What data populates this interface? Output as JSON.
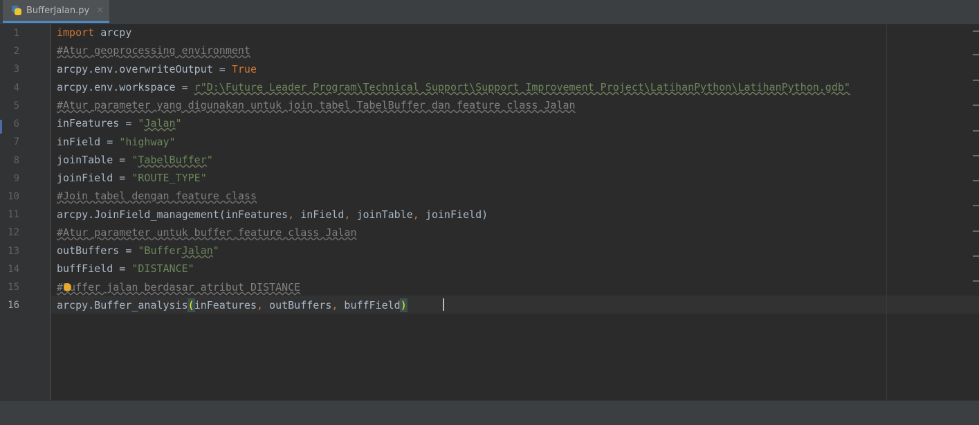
{
  "tab": {
    "filename": "BufferJalan.py",
    "close_glyph": "✕",
    "icon": "python-file-icon"
  },
  "gutter": {
    "line_numbers": [
      "1",
      "2",
      "3",
      "4",
      "5",
      "6",
      "7",
      "8",
      "9",
      "10",
      "11",
      "12",
      "13",
      "14",
      "15",
      "16"
    ],
    "current_line": "16"
  },
  "code": {
    "l1": {
      "kw": "import",
      "rest": " arcpy"
    },
    "l2": {
      "comment": "#Atur geoprocessing environment"
    },
    "l3": {
      "pre": "arcpy.env.overwriteOutput = ",
      "kw": "True"
    },
    "l4": {
      "pre": "arcpy.env.workspace = ",
      "str": "r\"D:\\Future Leader Program\\Technical Support\\Support Improvement Project\\LatihanPython\\LatihanPython.gdb\""
    },
    "l5": {
      "comment": "#Atur parameter yang digunakan untuk join tabel TabelBuffer dan feature class Jalan"
    },
    "l6": {
      "pre": "inFeatures = ",
      "q1": "\"",
      "word": "Jalan",
      "q2": "\""
    },
    "l7": {
      "pre": "inField = ",
      "str": "\"highway\""
    },
    "l8": {
      "pre": "joinTable = ",
      "q1": "\"",
      "word": "TabelBuffer",
      "q2": "\""
    },
    "l9": {
      "pre": "joinField = ",
      "str": "\"ROUTE_TYPE\""
    },
    "l10": {
      "comment": "#Join tabel dengan feature class"
    },
    "l11": {
      "pre": "arcpy.JoinField_management(inFeatures",
      "c1": ",",
      "p2": " inField",
      "c2": ",",
      "p3": " joinTable",
      "c3": ",",
      "p4": " joinField)"
    },
    "l12": {
      "comment": "#Atur parameter untuk buffer feature class Jalan"
    },
    "l13": {
      "pre": "outBuffers = ",
      "q1": "\"Buffer",
      "word": "Jalan",
      "q2": "\""
    },
    "l14": {
      "pre": "buffField = ",
      "str": "\"DISTANCE\""
    },
    "l15": {
      "comment": "#Buffer jalan berdasar atribut DISTANCE"
    },
    "l16": {
      "pre": "arcpy.Buffer_analysis",
      "open": "(",
      "a1": "inFeatures",
      "c1": ",",
      "a2": " outBuffers",
      "c2": ",",
      "a3": " buffField",
      "close": ")"
    }
  },
  "colors": {
    "keyword": "#cc7832",
    "string": "#6a8759",
    "comment": "#808080",
    "text": "#a9b7c6",
    "background": "#2b2b2b"
  }
}
